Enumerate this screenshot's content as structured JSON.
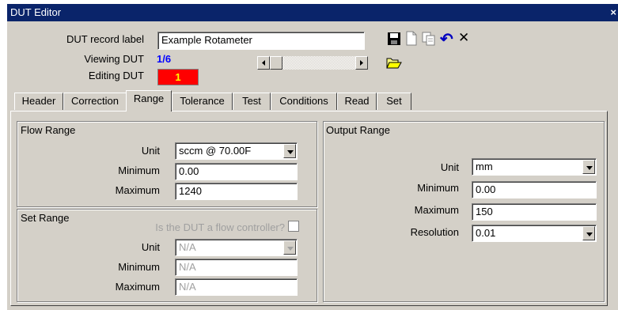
{
  "window": {
    "title": "DUT Editor",
    "close_glyph": "×"
  },
  "header": {
    "record_label_caption": "DUT record label",
    "record_label_value": "Example Rotameter",
    "viewing_caption": "Viewing DUT",
    "viewing_value": "1/6",
    "editing_caption": "Editing DUT",
    "editing_value": "1",
    "editing_color": "#ff0000",
    "viewing_color": "#0000ff"
  },
  "toolbar": {
    "icons": [
      "save-icon",
      "new-document-icon",
      "copy-icon",
      "undo-icon",
      "delete-icon",
      "open-folder-icon"
    ],
    "delete_glyph": "✕",
    "undo_glyph": "↶"
  },
  "tabs": [
    "Header",
    "Correction",
    "Range",
    "Tolerance",
    "Test",
    "Conditions",
    "Read",
    "Set"
  ],
  "active_tab": "Range",
  "flow_range": {
    "title": "Flow Range",
    "unit_label": "Unit",
    "unit_value": "sccm @ 70.00F",
    "minimum_label": "Minimum",
    "minimum_value": "0.00",
    "maximum_label": "Maximum",
    "maximum_value": "1240"
  },
  "set_range": {
    "title": "Set Range",
    "controller_question": "Is the DUT a flow controller?",
    "unit_label": "Unit",
    "unit_value": "N/A",
    "minimum_label": "Minimum",
    "minimum_value": "N/A",
    "maximum_label": "Maximum",
    "maximum_value": "N/A"
  },
  "output_range": {
    "title": "Output Range",
    "unit_label": "Unit",
    "unit_value": "mm",
    "minimum_label": "Minimum",
    "minimum_value": "0.00",
    "maximum_label": "Maximum",
    "maximum_value": "150",
    "resolution_label": "Resolution",
    "resolution_value": "0.01"
  }
}
